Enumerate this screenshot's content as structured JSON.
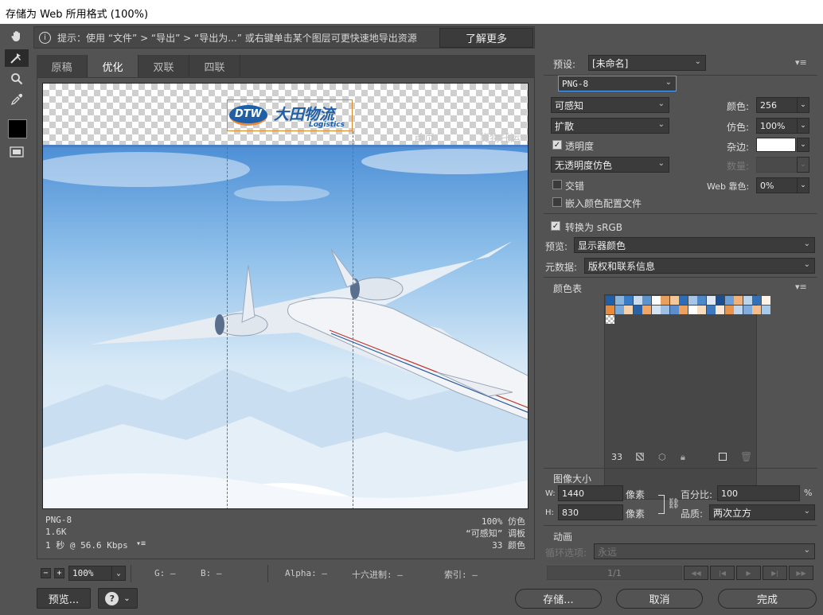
{
  "window": {
    "title": "存储为 Web 所用格式 (100%)"
  },
  "hint": {
    "icon": "info-icon",
    "text": "提示：使用 “文件” > “导出” > “导出为...” 或右键单击某个图层可更快速地导出资源",
    "learn_more": "了解更多"
  },
  "tabs": [
    {
      "label": "原稿"
    },
    {
      "label": "优化"
    },
    {
      "label": "双联"
    },
    {
      "label": "四联"
    }
  ],
  "image": {
    "logo_abbr": "DTW",
    "logo_cn": "大田物流",
    "logo_en": "Logistics",
    "nav1": "首页",
    "nav2": "货物托运"
  },
  "info": {
    "format": "PNG-8",
    "size": "1.6K",
    "speed": "1 秒 @ 56.6 Kbps",
    "dither": "100% 仿色",
    "palette": "“可感知” 调板",
    "colors": "33 颜色"
  },
  "statusbar": {
    "zoom": "100%",
    "g": "G: —",
    "b": "B: —",
    "alpha": "Alpha: —",
    "hex": "十六进制: —",
    "index": "索引: —"
  },
  "buttons": {
    "preview": "预览...",
    "save": "存储...",
    "cancel": "取消",
    "done": "完成"
  },
  "settings": {
    "preset_label": "预设:",
    "preset_value": "[未命名]",
    "format": "PNG-8",
    "reduction": "可感知",
    "colors_label": "颜色:",
    "colors_value": "256",
    "dither_algo": "扩散",
    "dither_label": "仿色:",
    "dither_value": "100%",
    "transparency": "透明度",
    "matte_label": "杂边:",
    "transparency_dither": "无透明度仿色",
    "amount_label": "数量:",
    "interlaced": "交错",
    "web_snap_label": "Web 靠色:",
    "web_snap_value": "0%",
    "embed_profile": "嵌入颜色配置文件",
    "convert_srgb": "转换为 sRGB",
    "preview_label": "预览:",
    "preview_value": "显示器颜色",
    "metadata_label": "元数据:",
    "metadata_value": "版权和联系信息"
  },
  "color_table": {
    "title": "颜色表",
    "count": "33"
  },
  "image_size": {
    "title": "图像大小",
    "w_label": "W:",
    "w_value": "1440",
    "h_label": "H:",
    "h_value": "830",
    "unit": "像素",
    "percent_label": "百分比:",
    "percent_value": "100",
    "percent_unit": "%",
    "quality_label": "品质:",
    "quality_value": "两次立方"
  },
  "animation": {
    "title": "动画",
    "loop_label": "循环选项:",
    "loop_value": "永远",
    "frame": "1/1"
  },
  "swatches_row1": [
    "#1f5fa8",
    "#8ab4dc",
    "#3a7cc4",
    "#c9dcef",
    "#5d94cf",
    "#ffffff",
    "#e8a060",
    "#f2c79a",
    "#2c6db8",
    "#a7c6e6",
    "#4f88c8",
    "#dfe9f4",
    "#1b4f92",
    "#6ea0d8",
    "#f0b27c",
    "#bcd3ec",
    "#3470b6",
    "#fdf3e8"
  ],
  "swatches_row2": [
    "#e88a3c",
    "#7aa8d8",
    "#f5d2ac",
    "#2a62a6",
    "#f0a666",
    "#d6e4f2",
    "#9ebfe4",
    "#5a8ecc",
    "#eea15e",
    "#ffffff",
    "#f7dcbe",
    "#3f7ac0",
    "#fbe8d4",
    "#e9944a",
    "#c0d6ee",
    "#80acde",
    "#f3be8c",
    "#a9c9e8"
  ],
  "colors": {
    "accent": "#4aa3ff",
    "panel": "#535353",
    "dark": "#3b3b3b"
  }
}
